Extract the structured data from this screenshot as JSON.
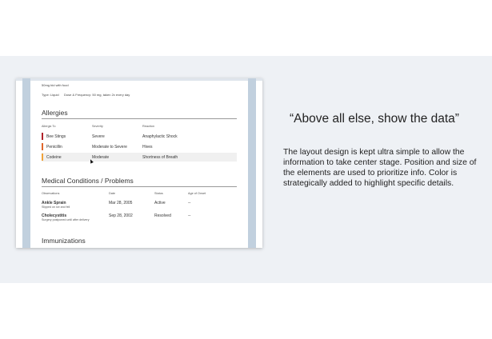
{
  "slide": {
    "quote": "“Above all else, show the data”",
    "description": "The layout design is kept ultra simple to allow the information to take center stage. Position and size of the elements are used to prioritize info. Color is strategically added to highlight specific details."
  },
  "record": {
    "prev_line1": "50mg bid with food",
    "prev_type": "Type: Liquid",
    "prev_dose": "Dose & Frequency: 50 mg, taken 2x every day",
    "allergies": {
      "title": "Allergies",
      "headers": [
        "Allergic To",
        "Severity",
        "Reaction"
      ],
      "rows": [
        {
          "allergen": "Bee Stings",
          "severity": "Severe",
          "reaction": "Anaphylactic Shock",
          "color": "#b0232a"
        },
        {
          "allergen": "Penicillin",
          "severity": "Moderate to Severe",
          "reaction": "Hives",
          "color": "#e0662b"
        },
        {
          "allergen": "Codeine",
          "severity": "Moderate",
          "reaction": "Shortness of Breath",
          "color": "#f0a23a"
        }
      ]
    },
    "conditions": {
      "title": "Medical Conditions / Problems",
      "headers": [
        "Observations",
        "Date",
        "Status",
        "Age of Onset"
      ],
      "rows": [
        {
          "name": "Ankle Sprain",
          "note": "Slipped on ice and fell",
          "date": "Mar 28, 2005",
          "status": "Active",
          "onset": "--"
        },
        {
          "name": "Cholecystitis",
          "note": "Surgery postponed until after delivery",
          "date": "Sep 28, 2002",
          "status": "Resolved",
          "onset": "--"
        }
      ]
    },
    "immunizations_title": "Immunizations"
  }
}
